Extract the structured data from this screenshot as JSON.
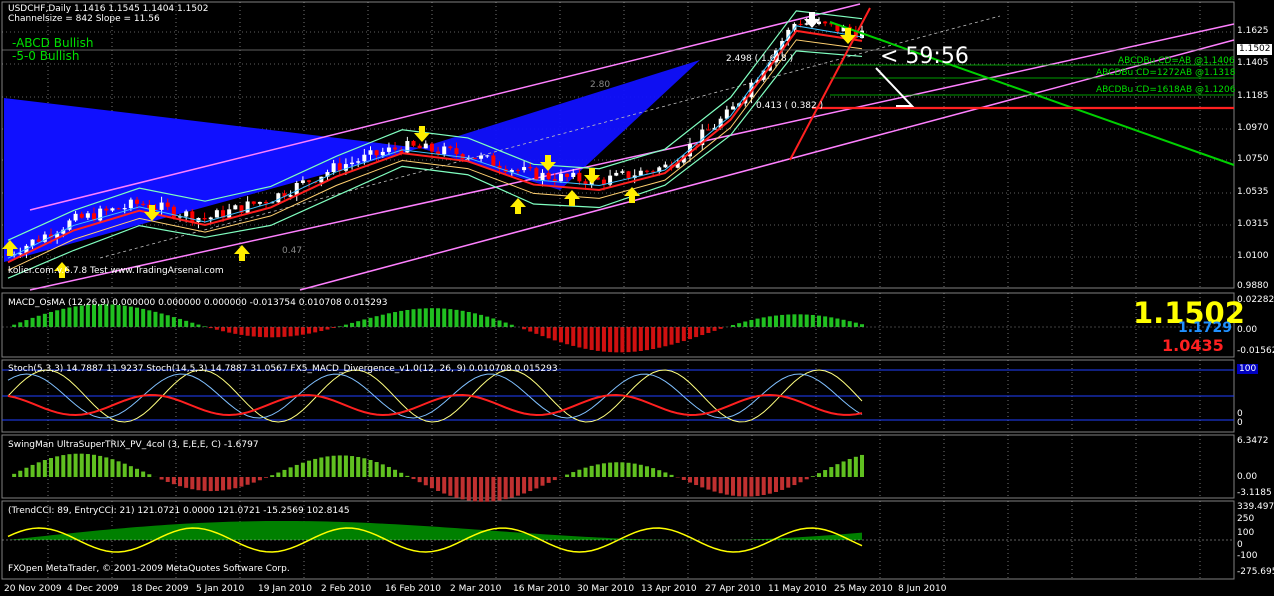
{
  "window": {
    "title": "USDCHF,Daily  1.1416 1.1545 1.1404 1.1502",
    "channel_info": "Channelsize = 842 Slope = 11.56",
    "pattern_labels": [
      "-ABCD Bullish",
      "-5-0 Bullish"
    ],
    "timer": "< 59:56",
    "watermark": "kolier.com.v.6.7.8 Test www.TradingArsenal.com",
    "copyright": "FXOpen MetaTrader, © 2001-2009 MetaQuotes Software Corp."
  },
  "price_axis": [
    "1.1625",
    "1.1405",
    "1.1185",
    "1.0970",
    "1.0750",
    "1.0535",
    "1.0315",
    "1.0100",
    "0.9880"
  ],
  "current_price": "1.1502",
  "fib_labels": [
    "ABCDBu CD=AB   @1.1406",
    "ABCDBu CD=1272AB  @1.1318",
    "ABCDBu CD=1618AB  @1.1206"
  ],
  "chart_annotations": [
    "2.498 ( 1.618 )",
    "0.413 ( 0.382 )",
    "2.80",
    "0.47"
  ],
  "big_prices": {
    "main": "1.1502",
    "mid": "1.1729",
    "low": "1.0435"
  },
  "date_axis": [
    "20 Nov 2009",
    "4 Dec 2009",
    "18 Dec 2009",
    "5 Jan 2010",
    "19 Jan 2010",
    "2 Feb 2010",
    "16 Feb 2010",
    "2 Mar 2010",
    "16 Mar 2010",
    "30 Mar 2010",
    "13 Apr 2010",
    "27 Apr 2010",
    "11 May 2010",
    "25 May 2010",
    "8 Jun 2010"
  ],
  "colors": {
    "background": "#000000",
    "grid": "#c0c0c0",
    "channel": "#ff80ff",
    "bull": "#ffffff",
    "bear": "#ff0000",
    "ma": "#ff2020",
    "band": "#80ffc0",
    "fill": "#1010ff"
  },
  "panels": {
    "macd": {
      "title": "MACD_OsMA (12,26,9) 0.000000 0.000000 0.000000 -0.013754 0.010708 0.015293",
      "axis": [
        "0.02282",
        "0.00",
        "-0.01562"
      ]
    },
    "stoch": {
      "title": "Stoch(5,3,3) 14.7887 11.9237  Stoch(14,5,3) 14.7887 31.0567  FX5_MACD_Divergence_v1.0(12, 26, 9) 0.010708 0.015293",
      "axis": [
        "100",
        "0",
        "0"
      ]
    },
    "trix": {
      "title": "SwingMan UltraSuperTRIX_PV_4col (3, E,E,E, C) -1.6797",
      "axis": [
        "6.3472",
        "0.00",
        "-3.1185"
      ]
    },
    "cci": {
      "title": "(TrendCCI: 89, EntryCCI: 21) 121.0721 0.0000 121.0721 -15.2569 102.8145",
      "axis": [
        "339.497",
        "250",
        "100",
        "0",
        "-100",
        "-275.695"
      ]
    }
  },
  "chart_data": {
    "type": "line",
    "title": "USDCHF,Daily  1.1416 1.1545 1.1404 1.1502",
    "x": [
      "20 Nov 2009",
      "4 Dec 2009",
      "18 Dec 2009",
      "5 Jan 2010",
      "19 Jan 2010",
      "2 Feb 2010",
      "16 Feb 2010",
      "2 Mar 2010",
      "16 Mar 2010",
      "30 Mar 2010",
      "13 Apr 2010",
      "27 Apr 2010",
      "11 May 2010",
      "25 May 2010",
      "8 Jun 2010"
    ],
    "series": [
      {
        "values": [
          1.0095,
          1.031,
          1.042,
          1.032,
          1.045,
          1.065,
          1.078,
          1.073,
          1.06,
          1.056,
          1.065,
          1.1,
          1.158,
          1.1502
        ]
      }
    ],
    "ylim": [
      0.988,
      1.17
    ]
  }
}
